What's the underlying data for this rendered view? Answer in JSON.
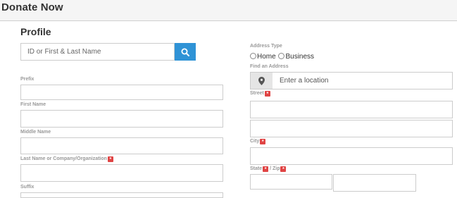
{
  "header": {
    "title": "Donate Now"
  },
  "profile": {
    "title": "Profile",
    "search_placeholder": "ID or First & Last Name",
    "prefix_label": "Prefix",
    "first_name_label": "First Name",
    "middle_name_label": "Middle Name",
    "last_name_label": "Last Name or Company/Organization",
    "suffix_label": "Suffix",
    "required_mark": "*"
  },
  "address": {
    "type_label": "Address Type",
    "option_home": "Home",
    "option_business": "Business",
    "find_label": "Find an Address",
    "location_placeholder": "Enter a location",
    "street_label": "Street",
    "city_label": "City",
    "state_label": "State",
    "zip_label": "Zip",
    "zip_separator": "/"
  },
  "colors": {
    "accent": "#2f93d6",
    "required": "#e04444"
  }
}
